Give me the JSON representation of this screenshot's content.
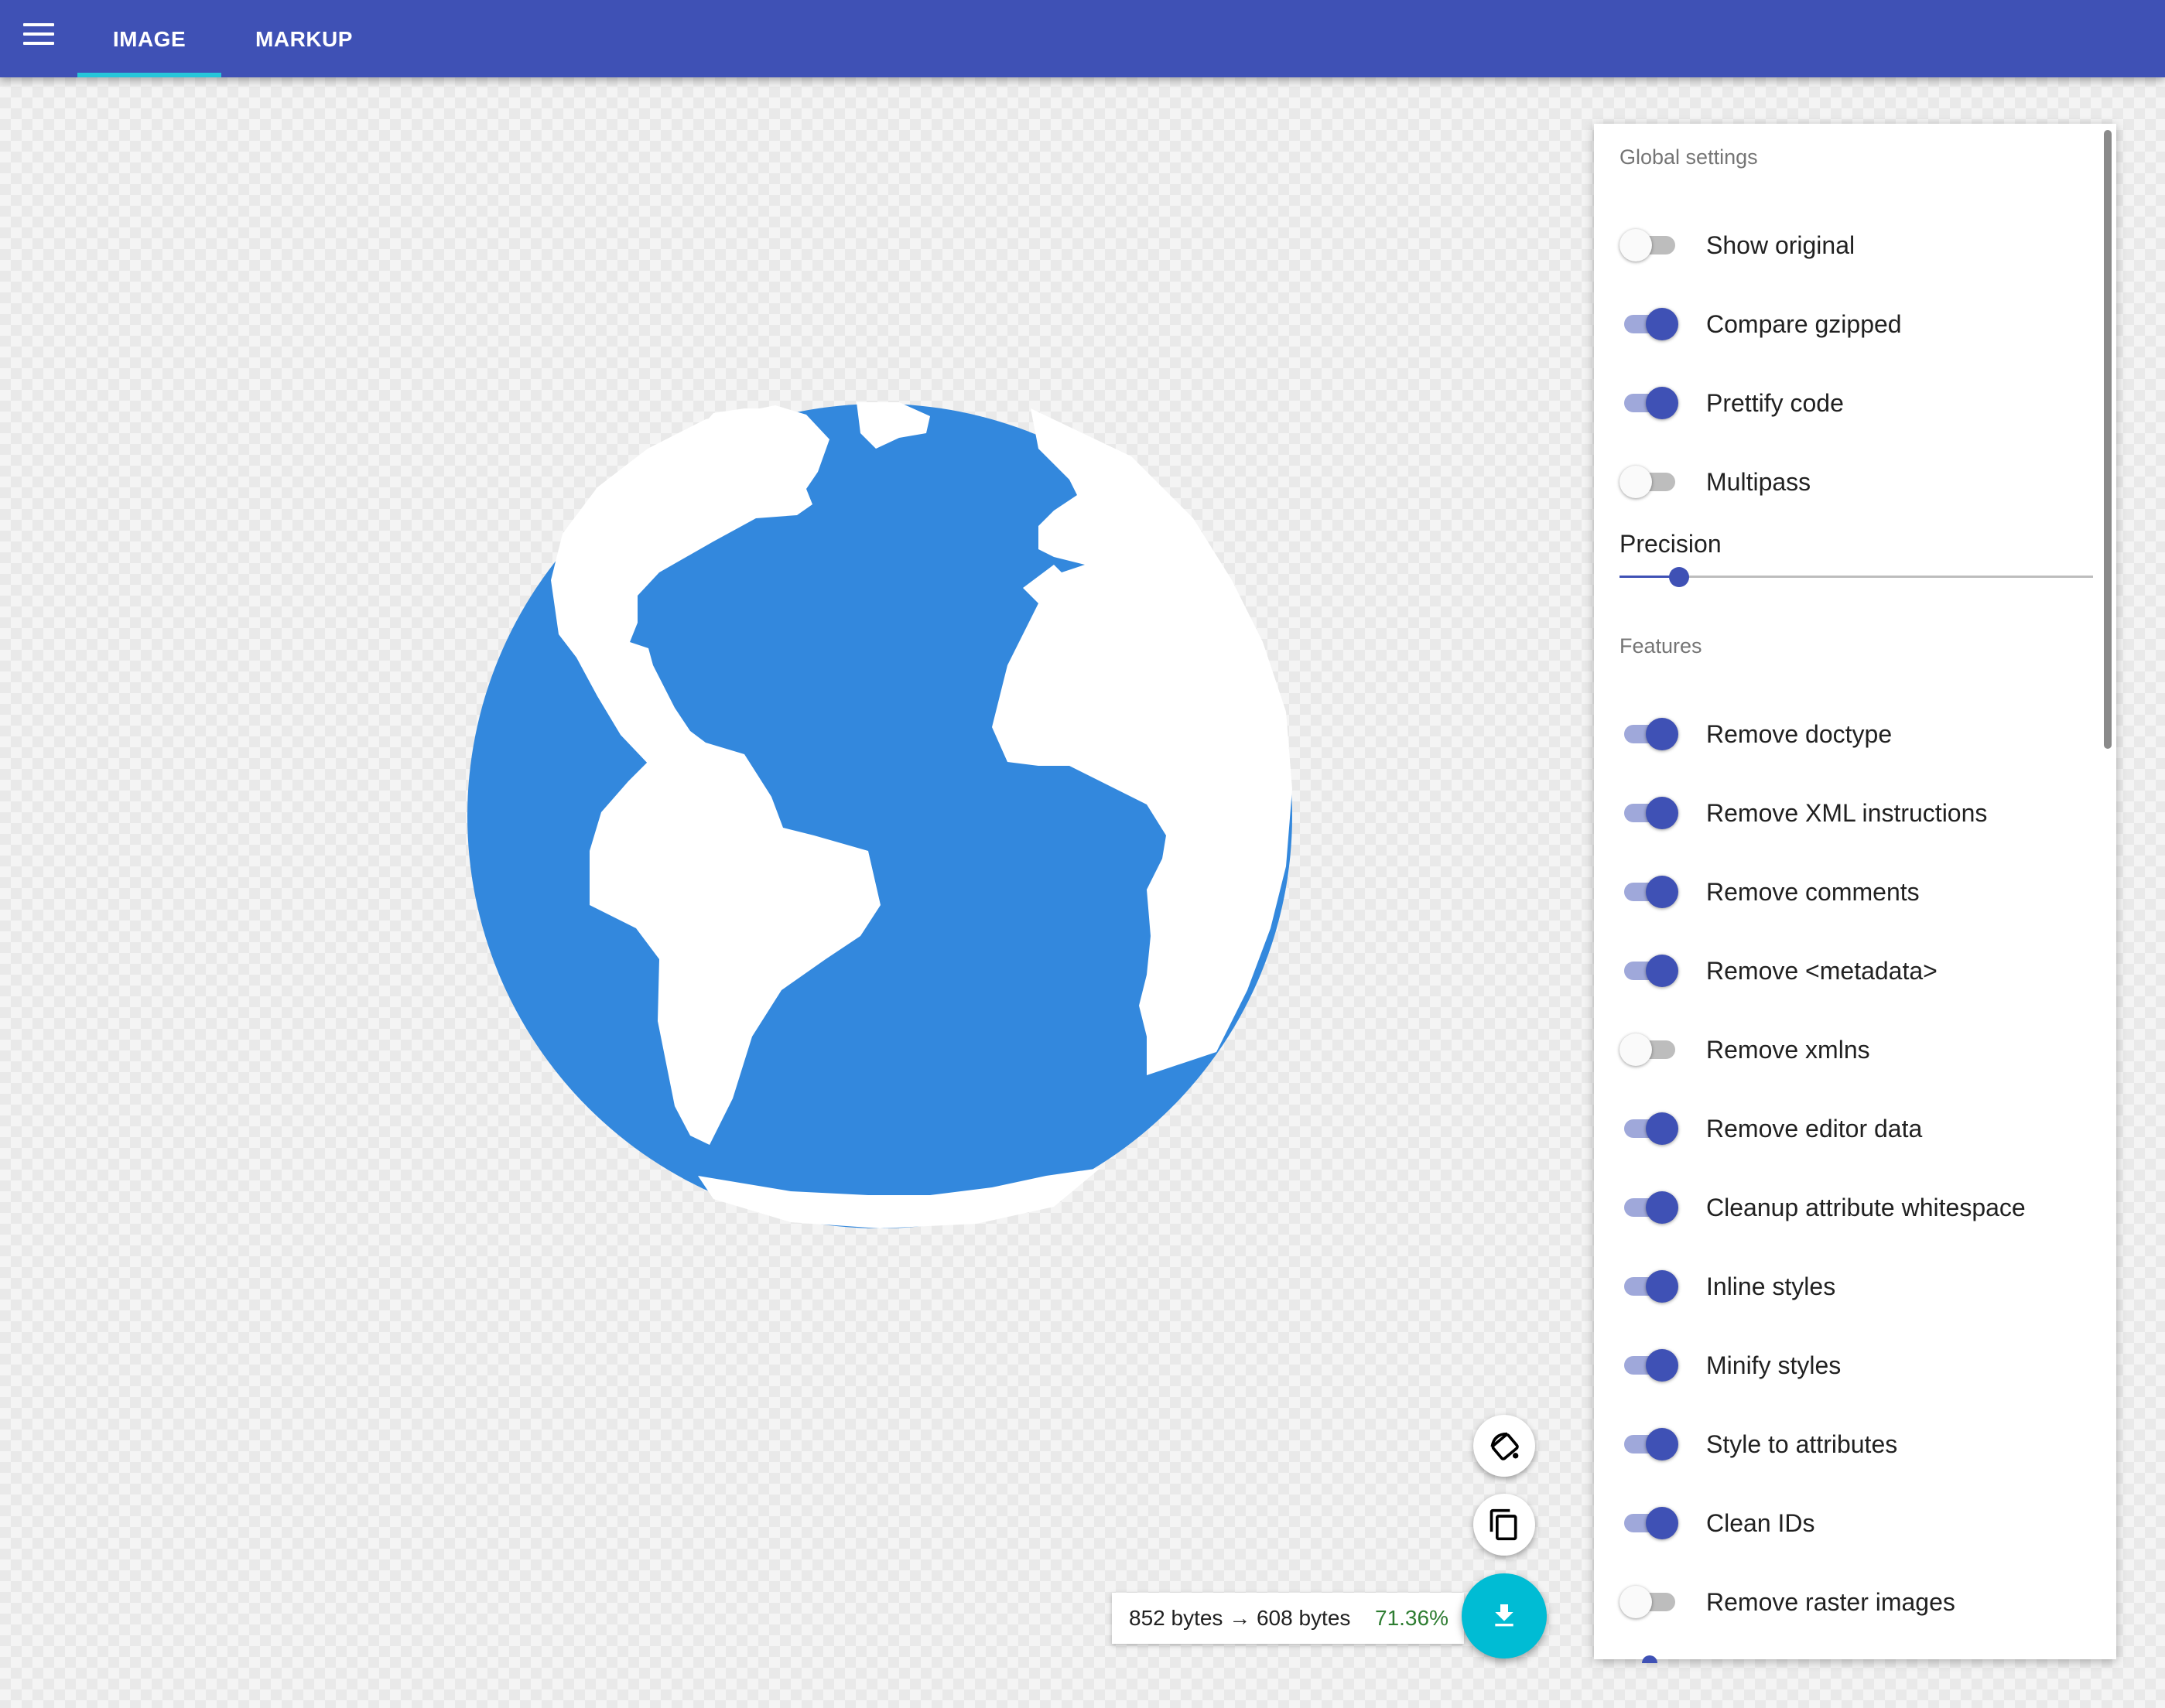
{
  "appbar": {
    "tabs": [
      {
        "label": "IMAGE",
        "active": true
      },
      {
        "label": "MARKUP",
        "active": false
      }
    ],
    "color": "#3f51b5",
    "active_tab_indicator_color": "#26c6da"
  },
  "preview": {
    "image": "globe (earth) illustration",
    "ocean_color": "#3388dd",
    "land_color": "#ffffff"
  },
  "settings": {
    "global_title": "Global settings",
    "global": [
      {
        "label": "Show original",
        "on": false
      },
      {
        "label": "Compare gzipped",
        "on": true
      },
      {
        "label": "Prettify code",
        "on": true
      },
      {
        "label": "Multipass",
        "on": false
      }
    ],
    "precision": {
      "label": "Precision",
      "value_fraction": 0.125
    },
    "features_title": "Features",
    "features": [
      {
        "label": "Remove doctype",
        "on": true
      },
      {
        "label": "Remove XML instructions",
        "on": true
      },
      {
        "label": "Remove comments",
        "on": true
      },
      {
        "label": "Remove <metadata>",
        "on": true
      },
      {
        "label": "Remove xmlns",
        "on": false
      },
      {
        "label": "Remove editor data",
        "on": true
      },
      {
        "label": "Cleanup attribute whitespace",
        "on": true
      },
      {
        "label": "Inline styles",
        "on": true
      },
      {
        "label": "Minify styles",
        "on": true
      },
      {
        "label": "Style to attributes",
        "on": true
      },
      {
        "label": "Clean IDs",
        "on": true
      },
      {
        "label": "Remove raster images",
        "on": false
      }
    ],
    "switch_on_color": "#3f51b5"
  },
  "results": {
    "sizes": "852 bytes → 608 bytes",
    "percent": "71.36%",
    "percent_color": "#2e7d32"
  },
  "actions": {
    "icons": [
      "paint-bucket-icon",
      "copy-icon",
      "download-icon"
    ],
    "download_color": "#00bcd4"
  }
}
